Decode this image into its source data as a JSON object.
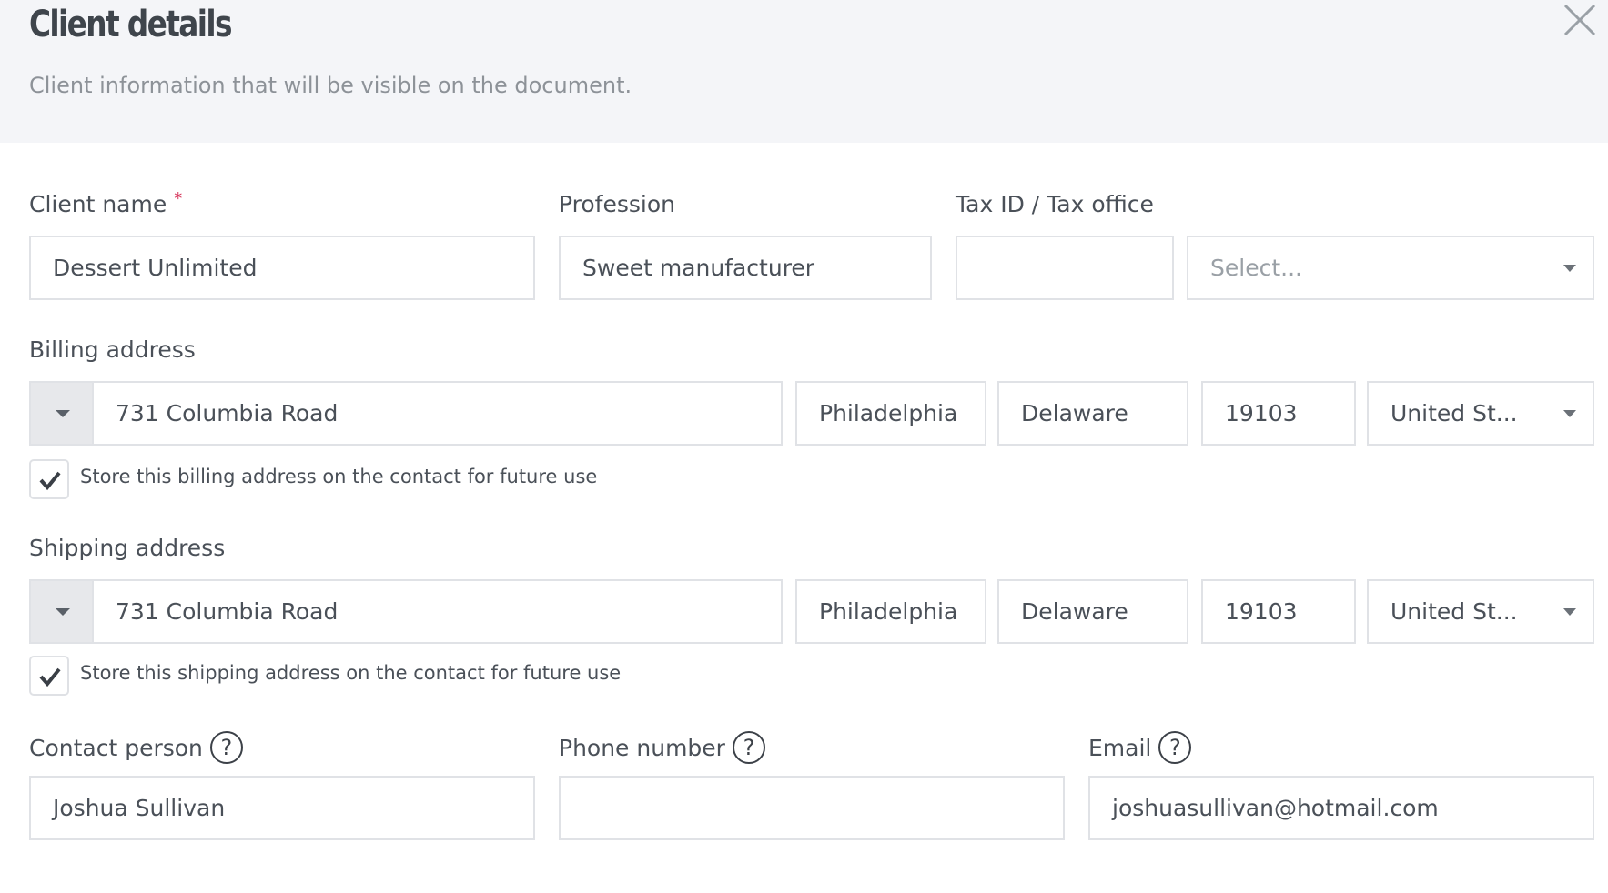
{
  "header": {
    "title": "Client details",
    "subtitle": "Client information that will be visible on the document."
  },
  "client": {
    "name_label": "Client name",
    "required_mark": "*",
    "name_value": "Dessert Unlimited",
    "profession_label": "Profession",
    "profession_value": "Sweet manufacturer",
    "tax_label": "Tax ID / Tax office",
    "tax_id_value": "",
    "tax_office_placeholder": "Select..."
  },
  "billing": {
    "label": "Billing address",
    "street": "731  Columbia Road",
    "city": "Philadelphia",
    "state": "Delaware",
    "zip": "19103",
    "country": "United St...",
    "store_label": "Store this billing address on the contact for future use",
    "store_checked": true
  },
  "shipping": {
    "label": "Shipping address",
    "street": "731  Columbia Road",
    "city": "Philadelphia",
    "state": "Delaware",
    "zip": "19103",
    "country": "United St...",
    "store_label": "Store this shipping address on the contact for future use",
    "store_checked": true
  },
  "contact": {
    "person_label": "Contact person",
    "person_value": "Joshua Sullivan",
    "phone_label": "Phone number",
    "phone_value": "",
    "email_label": "Email",
    "email_value": "joshuasullivan@hotmail.com",
    "help_glyph": "?"
  },
  "icons": {
    "close": "close-icon",
    "check": "checkmark-icon",
    "caret": "chevron-down-icon",
    "help": "question-circle-icon"
  },
  "colors": {
    "header_bg": "#f4f5f8",
    "required": "#d6345a",
    "border": "#e0e2e6"
  }
}
